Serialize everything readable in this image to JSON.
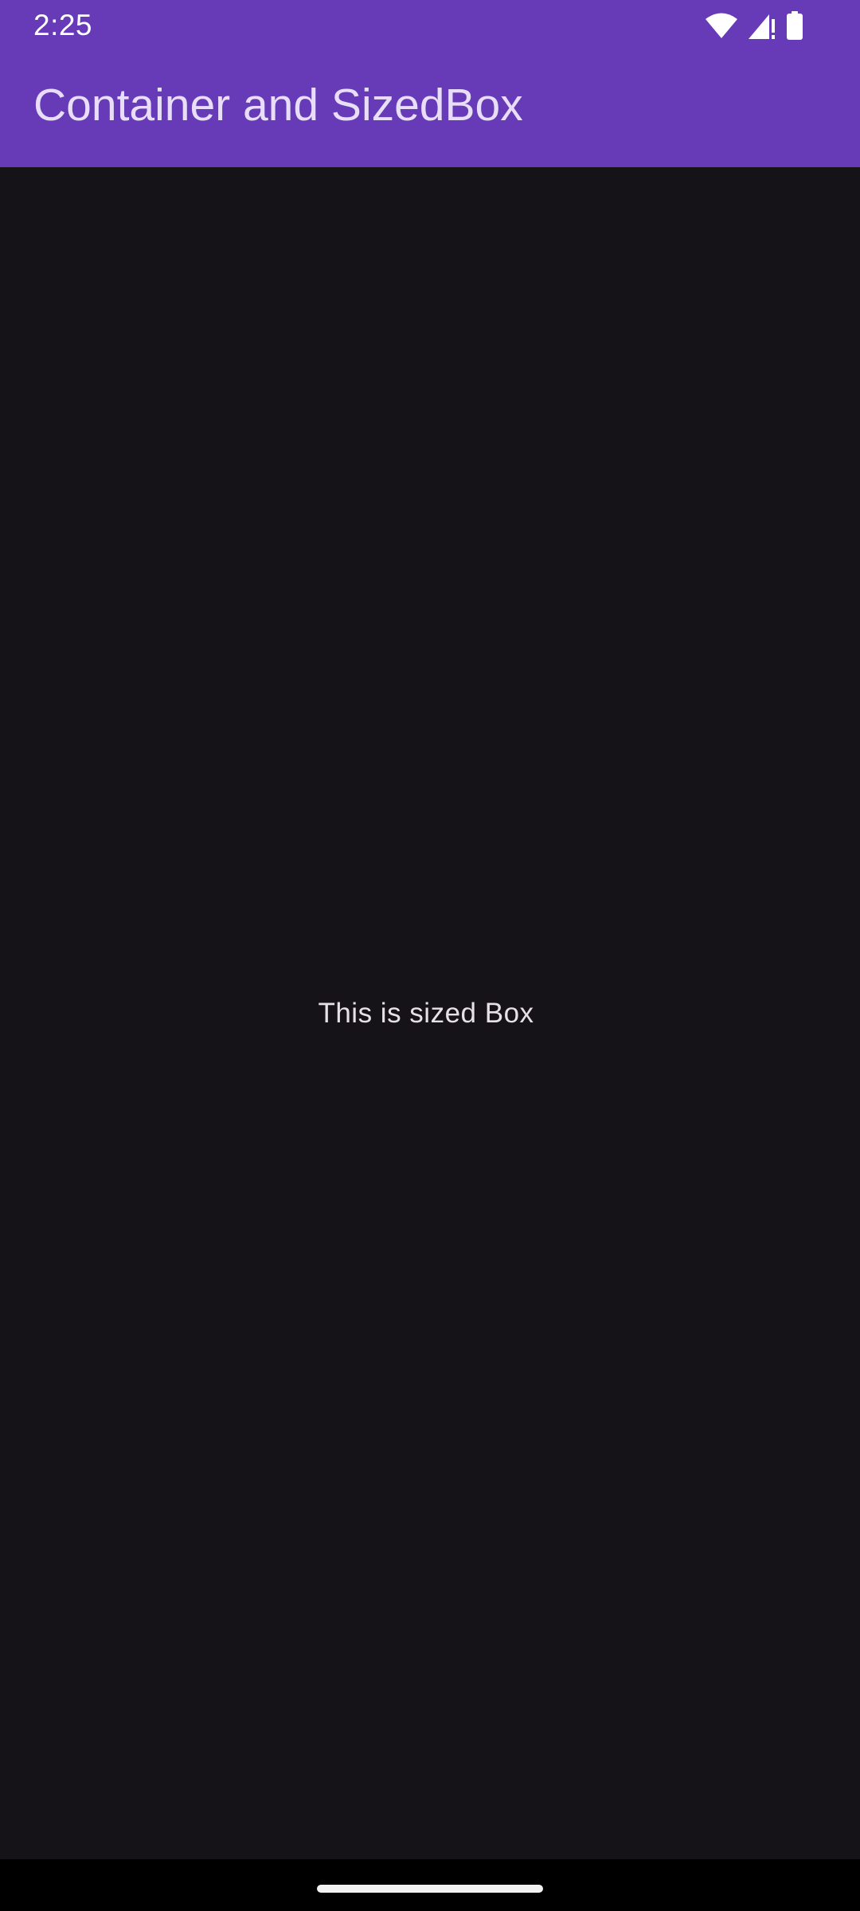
{
  "status_bar": {
    "time": "2:25",
    "icons": [
      "wifi-icon",
      "cellular-signal-icon",
      "battery-icon"
    ]
  },
  "app_bar": {
    "title": "Container and SizedBox"
  },
  "body": {
    "sized_box_text": "This is sized Box"
  },
  "colors": {
    "app_bar_background": "#673ab7",
    "app_bar_title": "#e8def8",
    "body_background": "#151218",
    "body_text": "#e6e0e9",
    "nav_bar_background": "#000000"
  }
}
